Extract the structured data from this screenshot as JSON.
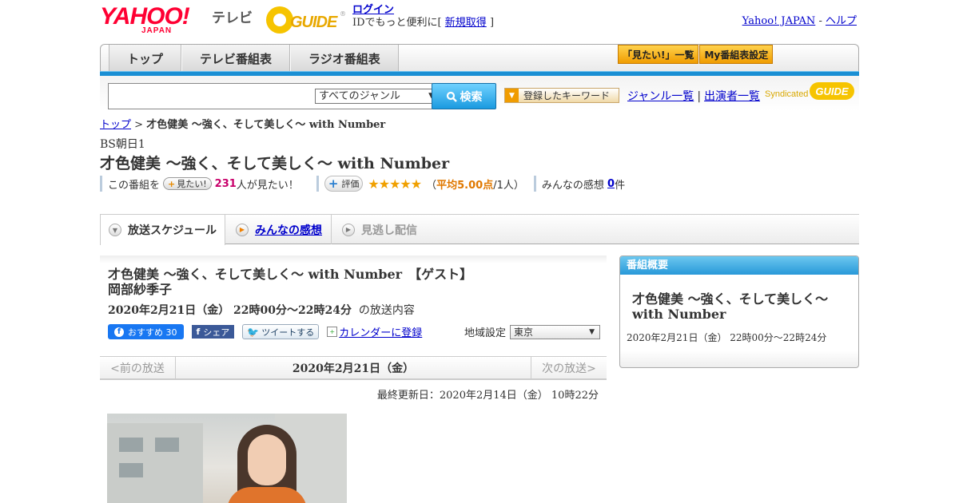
{
  "header": {
    "logo_text": "YAHOO!",
    "logo_sub": "JAPAN",
    "tv_label": "テレビ",
    "gguide_text": "GUIDE",
    "gguide_reg": "®",
    "login_label": "ログイン",
    "login_prompt": "IDでもっと便利に[",
    "signup_label": "新規取得",
    "login_close": "]",
    "yahoo_japan_link": "Yahoo! JAPAN",
    "link_sep": "-",
    "help_link": "ヘルプ"
  },
  "nav": {
    "tabs": [
      {
        "label": "トップ"
      },
      {
        "label": "テレビ番組表"
      },
      {
        "label": "ラジオ番組表"
      }
    ],
    "mitai_list": "「見たい!」一覧",
    "my_schedule": "My番組表設定"
  },
  "search": {
    "input_value": "",
    "genre_selected": "すべてのジャンル",
    "button_label": "検索",
    "keyword_button": "登録したキーワード",
    "genre_list_link": "ジャンル一覧",
    "performers_link": "出演者一覧",
    "sep": "|",
    "syndicated": "Syndicated",
    "gguide": "GUIDE"
  },
  "breadcrumb": {
    "top": "トップ",
    "sep": ">",
    "current": "才色健美 ～強く、そして美しく～ with Number"
  },
  "program": {
    "channel": "BS朝日1",
    "title": "才色健美 ～強く、そして美しく～ with Number",
    "rating": {
      "prefix": "この番組を",
      "mitai_button": "見たい!",
      "count": "231",
      "count_suffix": "人が見たい！",
      "eval_label": "評価",
      "stars": "★★★★★",
      "stars_value": 5,
      "avg_open": "（",
      "avg": "平均5.00点",
      "avg_close": "/1人）",
      "impressions_label": "みんなの感想",
      "impressions_count": "0",
      "impressions_suffix": "件"
    }
  },
  "subtabs": {
    "schedule": "放送スケジュール",
    "impressions": "みんなの感想",
    "missed": "見逃し配信"
  },
  "episode": {
    "title": "才色健美 ～強く、そして美しく～ with Number　【ゲスト】岡部紗季子",
    "date": "2020年2月21日（金）  22時00分～22時24分",
    "date_suffix": "の放送内容",
    "fb_label": "おすすめ 30",
    "share_label": "シェア",
    "tweet_label": "ツイートする",
    "calendar_label": "カレンダーに登録",
    "region_label": "地域設定",
    "region_value": "東京"
  },
  "pager": {
    "prev": "<前の放送",
    "current": "2020年2月21日（金）",
    "next": "次の放送>"
  },
  "updated": "最終更新日：2020年2月14日（金）  10時22分",
  "sidebar": {
    "header": "番組概要",
    "title": "才色健美 ～強く、そして美しく～ with Number",
    "date": "2020年2月21日（金）  22時00分～22時24分"
  }
}
